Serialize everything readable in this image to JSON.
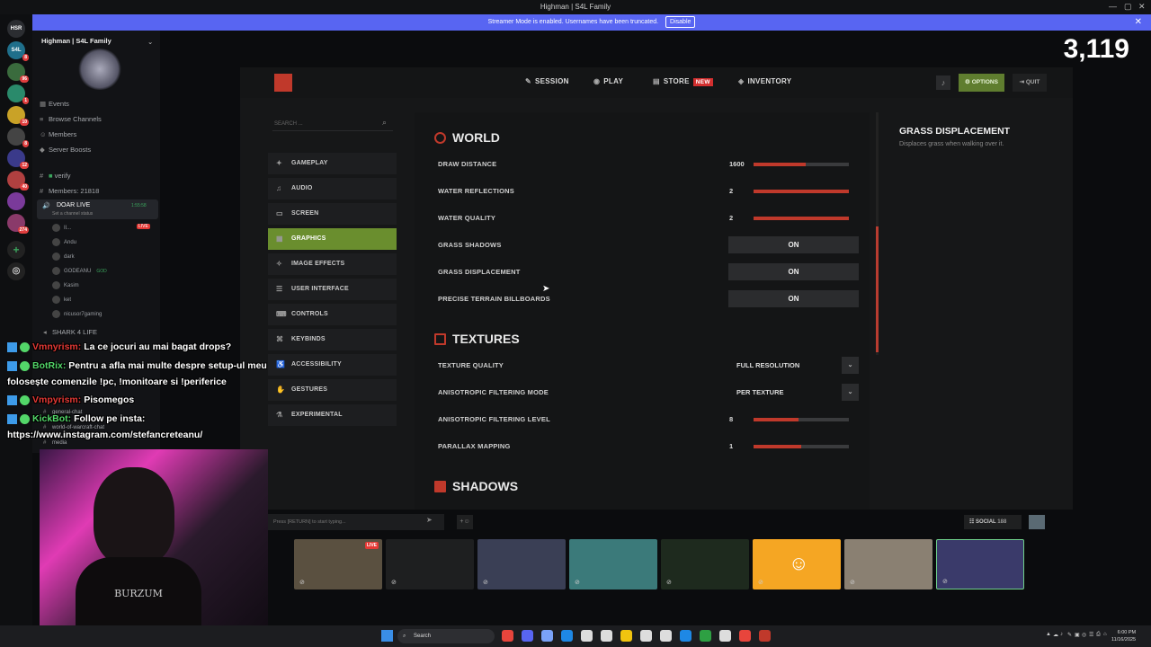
{
  "window": {
    "title": "Highman | S4L Family",
    "controls": [
      "—",
      "▢",
      "✕"
    ]
  },
  "banner": {
    "text": "Streamer Mode is enabled. Usernames have been truncated.",
    "disable": "Disable",
    "close": "✕"
  },
  "servers": [
    {
      "label": "HSR",
      "count": "",
      "color": "#2b2d31"
    },
    {
      "label": "S4L",
      "count": "8",
      "color": "#1f6f8b"
    },
    {
      "label": "",
      "count": "96",
      "color": "#3a6b3d"
    },
    {
      "label": "",
      "count": "1",
      "color": "#2a8a6b"
    },
    {
      "label": "",
      "count": "10",
      "color": "#c9a227"
    },
    {
      "label": "",
      "count": "8",
      "color": "#444"
    },
    {
      "label": "",
      "count": "12",
      "color": "#3a3a8a"
    },
    {
      "label": "",
      "count": "40",
      "color": "#b04040"
    },
    {
      "label": "",
      "count": "",
      "color": "#7a3a9a"
    },
    {
      "label": "",
      "count": "274",
      "color": "#8a3a6a"
    }
  ],
  "sidebar": {
    "server_name": "Highman | S4L Family",
    "items": [
      "Events",
      "Browse Channels",
      "Members",
      "Server Boosts"
    ],
    "channels": [
      "verify",
      "Members: 21818"
    ],
    "voice_channel": "DOAR LIVE",
    "voice_timer": "1:55:58",
    "voice_status": "Set a channel status",
    "members": [
      "Il...",
      "Andu",
      "dark",
      "GODEANU",
      "Kasim",
      "ket",
      "nicusor7gaming"
    ],
    "member_tags": [
      "LIVE",
      "",
      "",
      "GOD",
      "",
      "",
      ""
    ],
    "channel_after": "SHARK 4 LIFE",
    "text_channels": [
      "general-chat",
      "world-of-warcraft-chat",
      "media"
    ]
  },
  "stream_chat": [
    {
      "user": "Vmnyrism:",
      "text": " La ce jocuri au mai bagat drops?",
      "cls": "u1"
    },
    {
      "user": "BotRix:",
      "text": " Pentru a afla mai multe despre setup-ul meu",
      "cls": "u2"
    },
    {
      "user": "",
      "text": "folosește comenzile !pc, !monitoare si !periferice",
      "cls": ""
    },
    {
      "user": "Vmpyrism:",
      "text": " Pisomegos",
      "cls": "u1"
    },
    {
      "user": "KickBot:",
      "text": " Follow pe insta:",
      "cls": "u2"
    },
    {
      "user": "",
      "text": "https://www.instagram.com/stefancreteanu/",
      "cls": ""
    }
  ],
  "viewers": "3,119",
  "game": {
    "nav": {
      "session": "SESSION",
      "play": "PLAY",
      "store": "STORE",
      "store_badge": "NEW",
      "inventory": "INVENTORY",
      "options": "OPTIONS",
      "quit": "QUIT"
    },
    "search_placeholder": "SEARCH ...",
    "menu": [
      "GAMEPLAY",
      "AUDIO",
      "SCREEN",
      "GRAPHICS",
      "IMAGE EFFECTS",
      "USER INTERFACE",
      "CONTROLS",
      "KEYBINDS",
      "ACCESSIBILITY",
      "GESTURES",
      "EXPERIMENTAL"
    ],
    "menu_active": "GRAPHICS",
    "sections": {
      "world": "WORLD",
      "textures": "TEXTURES",
      "shadows": "SHADOWS"
    },
    "world_rows": [
      {
        "label": "DRAW DISTANCE",
        "value": "1600",
        "fraction": 0.55
      },
      {
        "label": "WATER REFLECTIONS",
        "value": "2",
        "fraction": 1.0
      },
      {
        "label": "WATER QUALITY",
        "value": "2",
        "fraction": 1.0
      }
    ],
    "toggles": [
      {
        "label": "GRASS SHADOWS",
        "value": "ON"
      },
      {
        "label": "GRASS DISPLACEMENT",
        "value": "ON"
      },
      {
        "label": "PRECISE TERRAIN BILLBOARDS",
        "value": "ON"
      }
    ],
    "texture_dropdowns": [
      {
        "label": "TEXTURE QUALITY",
        "value": "FULL RESOLUTION"
      },
      {
        "label": "ANISOTROPIC FILTERING MODE",
        "value": "PER TEXTURE"
      }
    ],
    "texture_sliders": [
      {
        "label": "ANISOTROPIC FILTERING LEVEL",
        "value": "8",
        "fraction": 0.47
      },
      {
        "label": "PARALLAX MAPPING",
        "value": "1",
        "fraction": 0.5
      }
    ],
    "detail": {
      "title": "GRASS DISPLACEMENT",
      "desc": "Displaces grass when walking over it."
    },
    "chat_placeholder": "Press [RETURN] to start typing...",
    "social_label": "SOCIAL",
    "social_count": "188",
    "tiles": [
      {
        "bg": "#5a5040",
        "live": "LIVE"
      },
      {
        "bg": "#1e1f20",
        "live": ""
      },
      {
        "bg": "#3a3f55",
        "live": ""
      },
      {
        "bg": "#3b7a7a",
        "live": ""
      },
      {
        "bg": "#1e2a1e",
        "live": ""
      },
      {
        "bg": "#f5a623",
        "live": ""
      },
      {
        "bg": "#8a8072",
        "live": ""
      },
      {
        "bg": "#3a3a6a",
        "live": ""
      }
    ]
  },
  "webcam_shirt": "BURZUM",
  "taskbar": {
    "search": "Search",
    "time": "6:00 PM",
    "date": "11/16/2025"
  }
}
